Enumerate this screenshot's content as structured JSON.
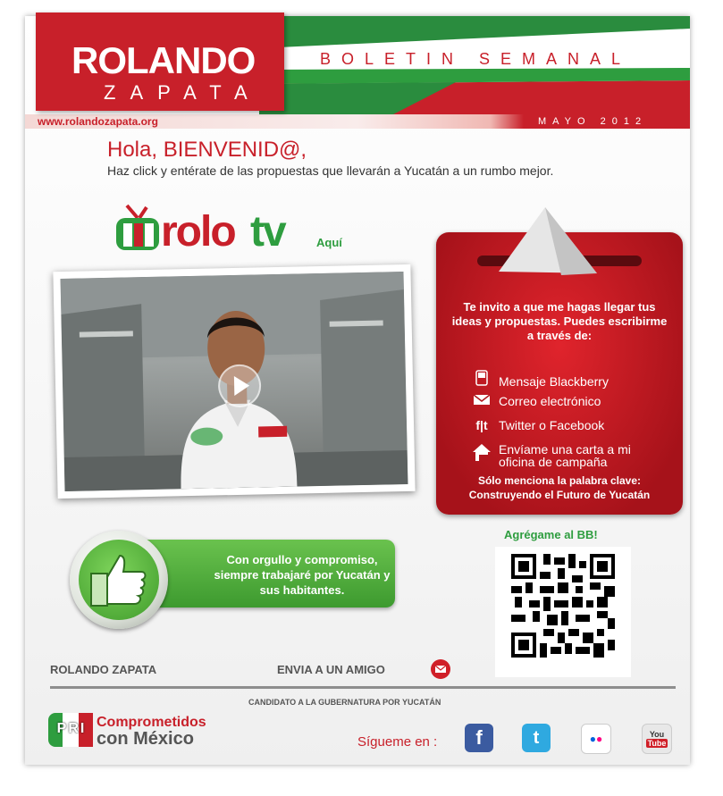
{
  "header": {
    "logo_name": "ROLANDO",
    "logo_sub": "ZAPATA",
    "title": "BOLETIN SEMANAL"
  },
  "urlbar": {
    "url": "www.rolandozapata.org",
    "date": "MAYO 2012"
  },
  "greeting": {
    "hello": "Hola, BIENVENID@,",
    "intro": "Haz click y entérate de las propuestas que llevarán a Yucatán a un rumbo mejor."
  },
  "rolotv": {
    "rolo": "rolo",
    "tv": "tv",
    "aqui": "Aquí"
  },
  "panel": {
    "invite": "Te invito a que me hagas llegar tus ideas y propuestas. Puedes escribirme a través de:",
    "options": [
      {
        "icon": "phone-icon",
        "label": "Mensaje Blackberry"
      },
      {
        "icon": "envelope-icon",
        "label": "Correo electrónico"
      },
      {
        "icon": "social-icon",
        "label": "Twitter o Facebook"
      },
      {
        "icon": "house-mail-icon",
        "label": "Envíame una carta a mi oficina de campaña"
      }
    ],
    "footer_line1": "Sólo menciona la palabra clave:",
    "footer_line2": "Construyendo el Futuro de Yucatán"
  },
  "banner": {
    "text": "Con orgullo y compromiso, siempre trabajaré por Yucatán y sus habitantes."
  },
  "bb": {
    "title": "Agrégame al BB!"
  },
  "footer": {
    "name": "ROLANDO ZAPATA",
    "envia": "ENVIA A UN AMIGO",
    "candidato": "CANDIDATO A LA GUBERNATURA POR YUCATÁN",
    "party_line1": "Comprometidos",
    "party_line2": "con México",
    "pri": "PRI",
    "sigueme": "Sígueme en :",
    "social": {
      "facebook": "f",
      "twitter": "t",
      "flickr": "●●",
      "youtube_top": "You",
      "youtube_bottom": "Tube"
    }
  },
  "colors": {
    "red": "#c8202a",
    "green": "#2e9d3f"
  }
}
